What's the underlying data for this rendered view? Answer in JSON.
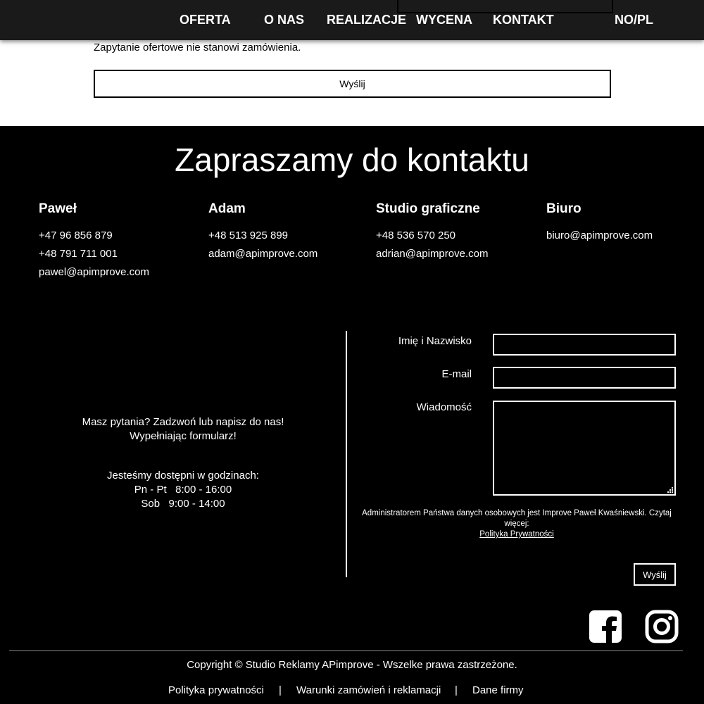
{
  "nav": {
    "items": [
      "OFERTA",
      "O NAS",
      "REALIZACJE",
      "WYCENA",
      "KONTAKT"
    ],
    "lang": "NO/PL"
  },
  "quote_form": {
    "disclaimer": "Zapytanie ofertowe nie stanowi zamówienia.",
    "submit_label": "Wyślij"
  },
  "contact": {
    "heading": "Zapraszamy do kontaktu",
    "people": [
      {
        "name": "Paweł",
        "lines": [
          "+47 96 856 879",
          "+48 791 711 001",
          "pawel@apimprove.com"
        ]
      },
      {
        "name": "Adam",
        "lines": [
          "+48 513 925 899",
          "adam@apimprove.com"
        ]
      },
      {
        "name": "Studio graficzne",
        "lines": [
          "+48 536 570 250",
          "adrian@apimprove.com"
        ]
      },
      {
        "name": "Biuro",
        "lines": [
          "biuro@apimprove.com"
        ]
      }
    ],
    "info": {
      "question_1": "Masz pytania? Zadzwoń lub napisz do nas!",
      "question_2": "Wypełniając formularz!",
      "hours_title": "Jesteśmy dostępni w godzinach:",
      "hours_weekdays": "Pn - Pt   8:00 - 16:00",
      "hours_saturday": "Sob   9:00 - 14:00"
    },
    "form": {
      "name_label": "Imię i Nazwisko",
      "email_label": "E-mail",
      "message_label": "Wiadomość",
      "privacy_text": "Administratorem Państwa danych osobowych jest Improve Paweł Kwaśniewski. Czytaj więcej:",
      "privacy_link": "Polityka Prywatności",
      "submit_label": "Wyślij"
    }
  },
  "social": {
    "icons": [
      "facebook-icon",
      "instagram-icon"
    ]
  },
  "footer": {
    "copyright": "Copyright © Studio Reklamy APimprove - Wszelke prawa zastrzeżone.",
    "links": [
      "Polityka prywatności",
      "Warunki zamówień i reklamacji",
      "Dane firmy"
    ],
    "separator": "|"
  }
}
